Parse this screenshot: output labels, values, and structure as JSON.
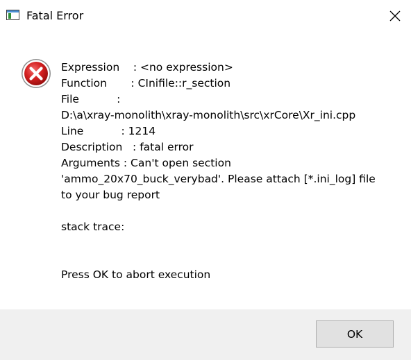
{
  "window": {
    "title": "Fatal Error",
    "icons": {
      "app": "app-window-icon",
      "close": "close-icon",
      "error": "error-icon"
    }
  },
  "message": {
    "expression_line": "Expression    : <no expression>",
    "function_line": "Function       : CInifile::r_section",
    "file_line": "File           :",
    "file_path": "D:\\a\\xray-monolith\\xray-monolith\\src\\xrCore\\Xr_ini.cpp",
    "line_line": "Line           : 1214",
    "description_line": "Description   : fatal error",
    "arguments_text": "Arguments     : Can't open section 'ammo_20x70_buck_verybad'. Please attach [*.ini_log] file to your bug report",
    "stack_trace": "stack trace:",
    "abort_prompt": "Press OK to abort execution"
  },
  "buttons": {
    "ok_label": "OK"
  },
  "colors": {
    "error_red": "#d42020",
    "footer_bg": "#f0f0f0",
    "button_bg": "#e1e1e1"
  }
}
